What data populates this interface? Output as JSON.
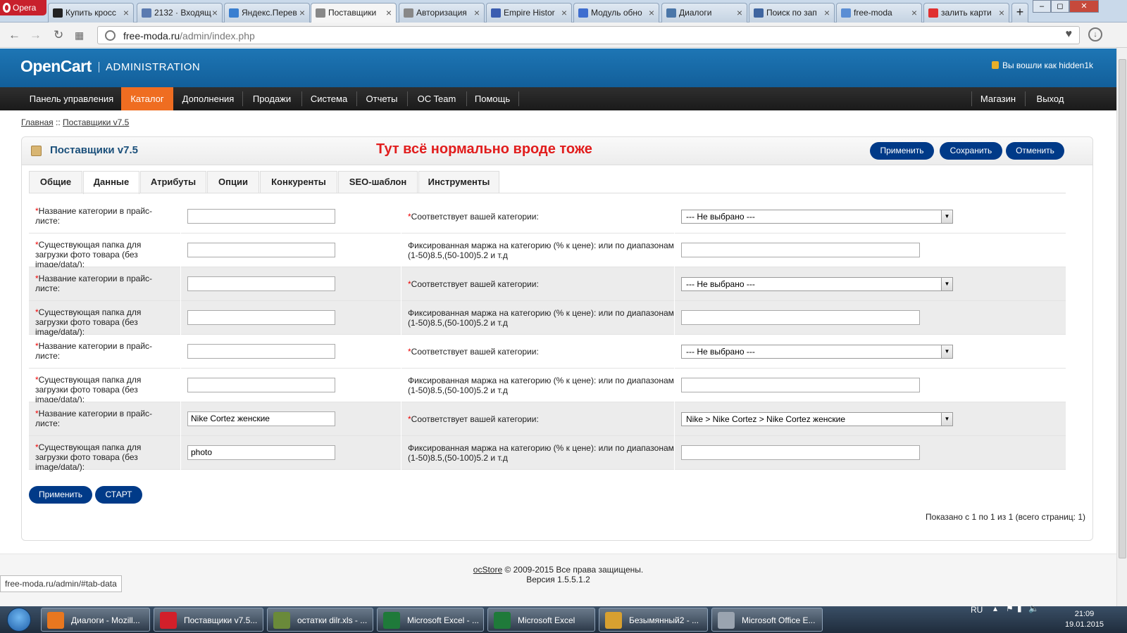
{
  "browser": {
    "menu_label": "Opera",
    "tabs": [
      {
        "label": "Купить кросс",
        "icon_color": "#222"
      },
      {
        "label": "2132 · Входящ",
        "icon_color": "#5a7ab0"
      },
      {
        "label": "Яндекс.Перев",
        "icon_color": "#3a7fd0"
      },
      {
        "label": "Поставщики",
        "icon_color": "#888"
      },
      {
        "label": "Авторизация",
        "icon_color": "#888"
      },
      {
        "label": "Empire Histor",
        "icon_color": "#3b5db0"
      },
      {
        "label": "Модуль обно",
        "icon_color": "#3f6ecf"
      },
      {
        "label": "Диалоги",
        "icon_color": "#4a76a8"
      },
      {
        "label": "Поиск по зап",
        "icon_color": "#3f65a0"
      },
      {
        "label": "free-moda",
        "icon_color": "#5b8ed4"
      },
      {
        "label": "залить карти",
        "icon_color": "#e03030"
      }
    ],
    "url_host": "free-moda.ru",
    "url_path": "/admin/index.php",
    "status_url": "free-moda.ru/admin/#tab-data"
  },
  "header": {
    "logo": "OpenCart",
    "admin_label": "ADMINISTRATION",
    "user_text": "Вы вошли как hidden1k"
  },
  "menu": {
    "items": [
      "Панель управления",
      "Каталог",
      "Дополнения",
      "Продажи",
      "Система",
      "Отчеты",
      "OC Team",
      "Помощь"
    ],
    "right_items": [
      "Магазин",
      "Выход"
    ],
    "active": "Каталог"
  },
  "breadcrumb": {
    "home": "Главная",
    "sep": " :: ",
    "current": "Поставщики v7.5"
  },
  "box": {
    "title": "Поставщики v7.5",
    "annotation": "Тут всё нормально вроде тоже",
    "buttons": {
      "apply": "Применить",
      "save": "Сохранить",
      "cancel": "Отменить"
    }
  },
  "tabs": [
    "Общие",
    "Данные",
    "Атрибуты",
    "Опции",
    "Конкуренты",
    "SEO-шаблон",
    "Инструменты"
  ],
  "active_tab": "Данные",
  "rows": [
    {
      "label": "Название категории в прайс-листе:",
      "required": true,
      "value": "",
      "label2": "Соответствует вашей категории:",
      "required2": true,
      "select": "--- Не выбрано ---"
    },
    {
      "label": "Существующая папка для загрузки фото товара (без image/data/):",
      "required": true,
      "value": "",
      "label2": "Фиксированная маржа на категорию (% к цене): или по диапазонам (1-50)8.5,(50-100)5.2 и т.д",
      "required2": false,
      "input2": ""
    },
    {
      "label": "Название категории в прайс-листе:",
      "required": true,
      "value": "",
      "label2": "Соответствует вашей категории:",
      "required2": true,
      "select": "--- Не выбрано ---"
    },
    {
      "label": "Существующая папка для загрузки фото товара (без image/data/):",
      "required": true,
      "value": "",
      "label2": "Фиксированная маржа на категорию (% к цене): или по диапазонам (1-50)8.5,(50-100)5.2 и т.д",
      "required2": false,
      "input2": ""
    },
    {
      "label": "Название категории в прайс-листе:",
      "required": true,
      "value": "",
      "label2": "Соответствует вашей категории:",
      "required2": true,
      "select": "--- Не выбрано ---"
    },
    {
      "label": "Существующая папка для загрузки фото товара (без image/data/):",
      "required": true,
      "value": "",
      "label2": "Фиксированная маржа на категорию (% к цене): или по диапазонам (1-50)8.5,(50-100)5.2 и т.д",
      "required2": false,
      "input2": ""
    },
    {
      "label": "Название категории в прайс-листе:",
      "required": true,
      "value": "Nike Cortez женские",
      "label2": "Соответствует вашей категории:",
      "required2": true,
      "select": "Nike > Nike Cortez > Nike Cortez женские"
    },
    {
      "label": "Существующая папка для загрузки фото товара (без image/data/):",
      "required": true,
      "value": "photo",
      "label2": "Фиксированная маржа на категорию (% к цене): или по диапазонам (1-50)8.5,(50-100)5.2 и т.д",
      "required2": false,
      "input2": ""
    }
  ],
  "bottom_buttons": {
    "apply": "Применить",
    "start": "СТАРТ"
  },
  "pager": "Показано с 1 по 1 из 1 (всего страниц: 1)",
  "footer": {
    "brand": "ocStore",
    "copy": " © 2009-2015 Все права защищены.",
    "version": "Версия 1.5.5.1.2"
  },
  "taskbar": {
    "items": [
      {
        "label": "Диалоги - Mozill...",
        "icon_color": "#e8771f"
      },
      {
        "label": "Поставщики v7.5...",
        "icon_color": "#d21f2a"
      },
      {
        "label": "остатки dilr.xls - ...",
        "icon_color": "#6a8a3a"
      },
      {
        "label": "Microsoft Excel - ...",
        "icon_color": "#1f7a3a"
      },
      {
        "label": "Microsoft Excel",
        "icon_color": "#1f7a3a"
      },
      {
        "label": "Безымянный2 - ...",
        "icon_color": "#d8a030"
      },
      {
        "label": "Microsoft Office E...",
        "icon_color": "#9aa4b0"
      }
    ],
    "lang": "RU",
    "time": "21:09",
    "date": "19.01.2015"
  }
}
